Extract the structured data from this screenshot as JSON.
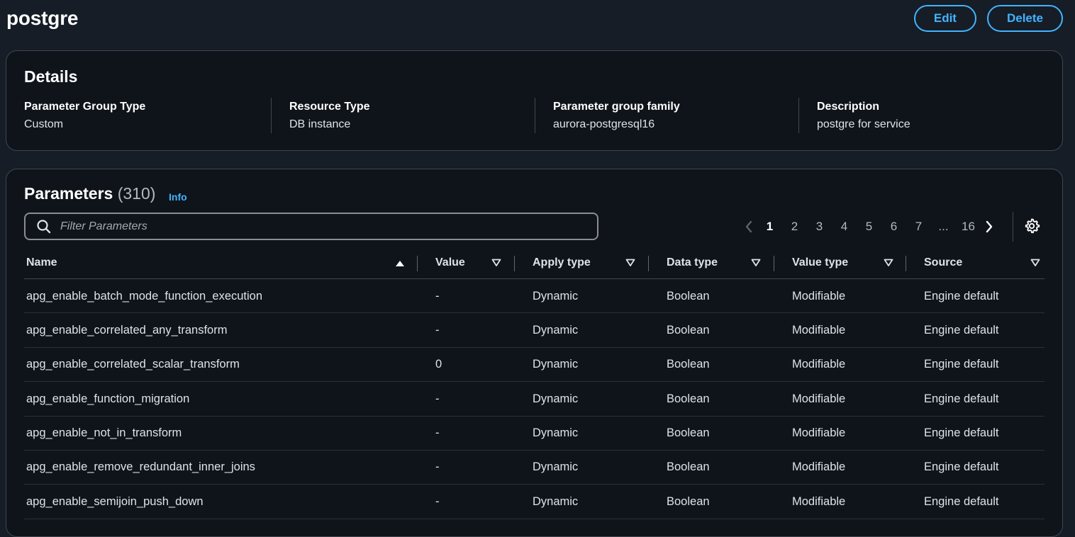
{
  "header": {
    "title": "postgre",
    "edit_label": "Edit",
    "delete_label": "Delete"
  },
  "details": {
    "heading": "Details",
    "fields": [
      {
        "label": "Parameter Group Type",
        "value": "Custom"
      },
      {
        "label": "Resource Type",
        "value": "DB instance"
      },
      {
        "label": "Parameter group family",
        "value": "aurora-postgresql16"
      },
      {
        "label": "Description",
        "value": "postgre for service"
      }
    ]
  },
  "parameters": {
    "heading": "Parameters",
    "count": "(310)",
    "info_label": "Info",
    "filter_placeholder": "Filter Parameters",
    "pagination": {
      "current": "1",
      "pages": [
        "1",
        "2",
        "3",
        "4",
        "5",
        "6",
        "7"
      ],
      "ellipsis": "...",
      "last": "16"
    },
    "columns": [
      "Name",
      "Value",
      "Apply type",
      "Data type",
      "Value type",
      "Source"
    ],
    "rows": [
      {
        "name": "apg_enable_batch_mode_function_execution",
        "value": "-",
        "apply_type": "Dynamic",
        "data_type": "Boolean",
        "value_type": "Modifiable",
        "source": "Engine default"
      },
      {
        "name": "apg_enable_correlated_any_transform",
        "value": "-",
        "apply_type": "Dynamic",
        "data_type": "Boolean",
        "value_type": "Modifiable",
        "source": "Engine default"
      },
      {
        "name": "apg_enable_correlated_scalar_transform",
        "value": "0",
        "apply_type": "Dynamic",
        "data_type": "Boolean",
        "value_type": "Modifiable",
        "source": "Engine default"
      },
      {
        "name": "apg_enable_function_migration",
        "value": "-",
        "apply_type": "Dynamic",
        "data_type": "Boolean",
        "value_type": "Modifiable",
        "source": "Engine default"
      },
      {
        "name": "apg_enable_not_in_transform",
        "value": "-",
        "apply_type": "Dynamic",
        "data_type": "Boolean",
        "value_type": "Modifiable",
        "source": "Engine default"
      },
      {
        "name": "apg_enable_remove_redundant_inner_joins",
        "value": "-",
        "apply_type": "Dynamic",
        "data_type": "Boolean",
        "value_type": "Modifiable",
        "source": "Engine default"
      },
      {
        "name": "apg_enable_semijoin_push_down",
        "value": "-",
        "apply_type": "Dynamic",
        "data_type": "Boolean",
        "value_type": "Modifiable",
        "source": "Engine default"
      }
    ]
  },
  "icons": {
    "search": "search-icon",
    "prev": "chevron-left-icon",
    "next": "chevron-right-icon",
    "settings": "gear-icon",
    "sort_asc": "caret-up-filled-icon",
    "sort_none": "caret-down-outline-icon"
  },
  "colors": {
    "background": "#161d26",
    "panel": "#0f141a",
    "accent": "#42b4ff",
    "border": "#424650"
  }
}
